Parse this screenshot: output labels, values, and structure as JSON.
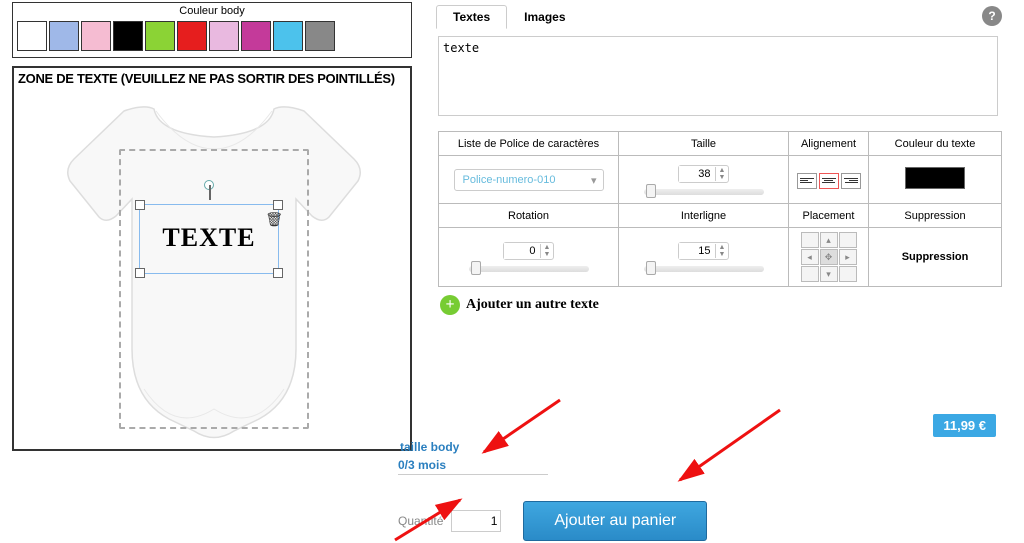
{
  "colors": {
    "title": "Couleur body",
    "items": [
      "#ffffff",
      "#9fb8e8",
      "#f5bcd2",
      "#000000",
      "#8bd335",
      "#e61e1e",
      "#e9b9e0",
      "#c43a9a",
      "#4cc2ec",
      "#888888"
    ]
  },
  "zone": {
    "title": "ZONE DE TEXTE (VEUILLEZ NE PAS SORTIR DES POINTILLÉS)"
  },
  "design_text": "TEXTE",
  "tabs": {
    "textes": "Textes",
    "images": "Images"
  },
  "textarea_value": "texte",
  "headers": {
    "font": "Liste de Police de caractères",
    "size": "Taille",
    "align": "Alignement",
    "color": "Couleur du texte",
    "rotation": "Rotation",
    "interline": "Interligne",
    "placement": "Placement",
    "delete": "Suppression"
  },
  "controls": {
    "font_selected": "Police-numero-010",
    "size_value": "38",
    "rotation_value": "0",
    "interline_value": "15",
    "delete_label": "Suppression",
    "text_color": "#000000"
  },
  "add_label": "Ajouter un autre texte",
  "price": "11,99 €",
  "size": {
    "label": "taille body",
    "value": "0/3 mois"
  },
  "qty": {
    "label": "Quantité",
    "value": "1"
  },
  "cart_label": "Ajouter au panier"
}
